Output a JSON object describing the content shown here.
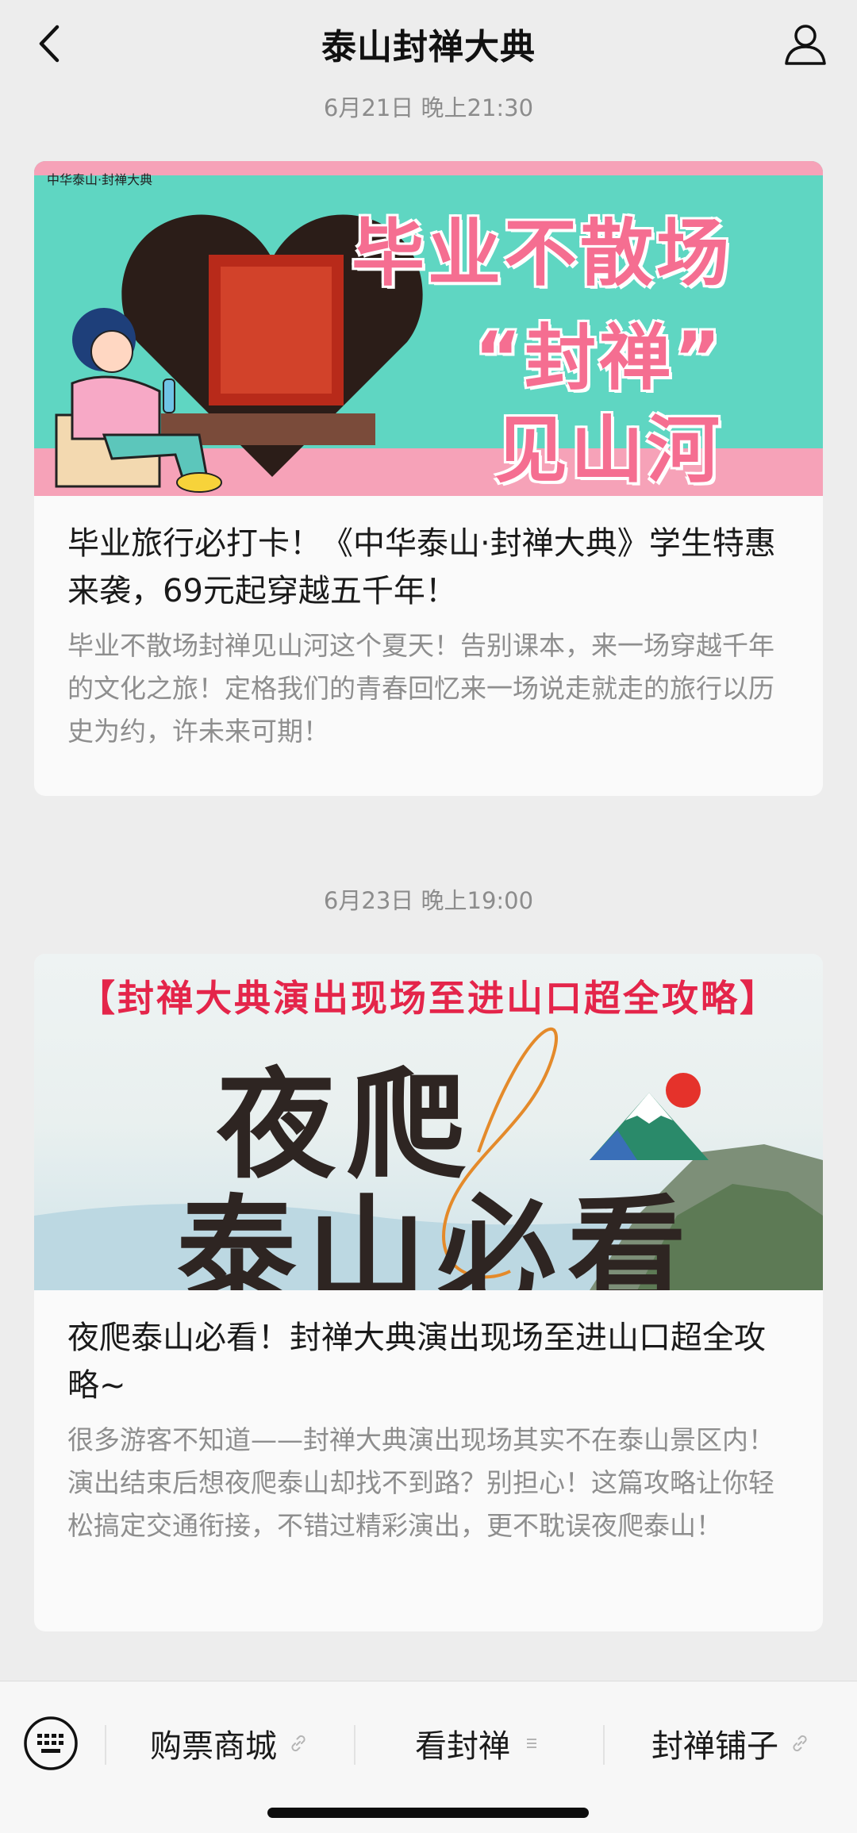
{
  "navbar": {
    "title": "泰山封禅大典",
    "back_icon": "chevron-left-icon",
    "profile_icon": "person-icon"
  },
  "messages": [
    {
      "timestamp": "6月21日 晚上21:30",
      "image": {
        "logo": "中华泰山·封禅大典",
        "headline_1": "毕业不散场",
        "headline_2": "“封禅”",
        "headline_3": "见山河"
      },
      "title": "毕业旅行必打卡！《中华泰山·封禅大典》学生特惠来袭，69元起穿越五千年！",
      "summary": "毕业不散场封禅见山河这个夏天！告别课本，来一场穿越千年的文化之旅！定格我们的青春回忆来一场说走就走的旅行以历史为约，许未来可期！"
    },
    {
      "timestamp": "6月23日 晚上19:00",
      "image": {
        "banner": "【封禅大典演出现场至进山口超全攻略】",
        "big_1": "夜爬",
        "big_2": "泰山必看"
      },
      "title": "夜爬泰山必看！封禅大典演出现场至进山口超全攻略~",
      "summary": "很多游客不知道——封禅大典演出现场其实不在泰山景区内！演出结束后想夜爬泰山却找不到路？别担心！这篇攻略让你轻松搞定交通衔接，不错过精彩演出，更不耽误夜爬泰山！"
    }
  ],
  "tabbar": {
    "keyboard_icon": "keyboard-icon",
    "tabs": [
      {
        "label": "购票商城",
        "icon": "link-icon"
      },
      {
        "label": "看封禅",
        "icon": "menu-icon"
      },
      {
        "label": "封禅铺子",
        "icon": "link-icon"
      }
    ]
  },
  "colors": {
    "background": "#ededed",
    "card": "#fafafa",
    "accent_pink": "#f56e91",
    "banner_red": "#e4254a"
  }
}
